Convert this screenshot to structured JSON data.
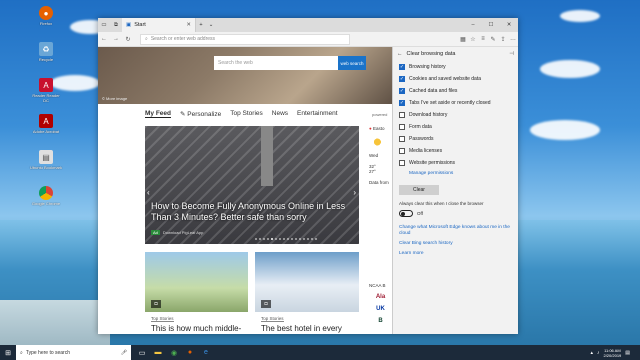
{
  "desktop": {
    "icons": [
      {
        "label": "Firefox",
        "glyph": "firefox-icon",
        "color": "#e66000"
      },
      {
        "label": "Recycle",
        "glyph": "recycle-bin-icon",
        "color": "#6aa6d6"
      },
      {
        "label": "Reader Reader DC",
        "glyph": "pdf-icon",
        "color": "#c8102e"
      },
      {
        "label": "Adobe Acrobat",
        "glyph": "pdf-icon",
        "color": "#b00000"
      },
      {
        "label": "Ubuntu Bookmark",
        "glyph": "file-icon",
        "color": "#e0e0e0"
      },
      {
        "label": "Google Chrome",
        "glyph": "chrome-icon",
        "color": "#4caf50"
      }
    ]
  },
  "browser": {
    "tab_title": "Start",
    "address_placeholder": "Search or enter web address",
    "hero_credit": "© More image",
    "search_placeholder": "Search the web",
    "search_button": "web search",
    "feed_tabs": [
      "My Feed",
      "Personalize",
      "Top Stories",
      "News",
      "Entertainment"
    ],
    "powered_by": "powered",
    "big_card": {
      "headline": "How to Become Fully Anonymous Online in Less Than 3 Minutes? Better safe than sorry",
      "ad_tag": "Ad",
      "source": "Download PigLeaf App"
    },
    "weather": {
      "place": "Easto",
      "day": "Wed",
      "temp_high": "32°",
      "temp_low": "27°",
      "src": "Data from"
    },
    "card1": {
      "category": "Top Stories",
      "title": "This is how much middle-class families earn in"
    },
    "card2": {
      "category": "Top Stories",
      "title": "The best hotel in every state, according to travelers"
    },
    "ncaa": {
      "label": "NCAA B",
      "teams": [
        "Ala",
        "UK",
        "B"
      ]
    }
  },
  "panel": {
    "title": "Clear browsing data",
    "options": [
      {
        "label": "Browsing history",
        "checked": true
      },
      {
        "label": "Cookies and saved website data",
        "checked": true
      },
      {
        "label": "Cached data and files",
        "checked": true
      },
      {
        "label": "Tabs I've set aside or recently closed",
        "checked": true
      },
      {
        "label": "Download history",
        "checked": false
      },
      {
        "label": "Form data",
        "checked": false
      },
      {
        "label": "Passwords",
        "checked": false
      },
      {
        "label": "Media licenses",
        "checked": false
      },
      {
        "label": "Website permissions",
        "checked": false
      }
    ],
    "manage_link": "Manage permissions",
    "clear_button": "Clear",
    "always_label": "Always clear this when I close the browser",
    "toggle_state": "Off",
    "link_learn": "Change what Microsoft Edge knows about me in the cloud",
    "link_bing": "Clear Bing search history",
    "link_more": "Learn more"
  },
  "taskbar": {
    "search_placeholder": "Type here to search",
    "time": "11:06 AM",
    "date": "2/20/2019"
  }
}
